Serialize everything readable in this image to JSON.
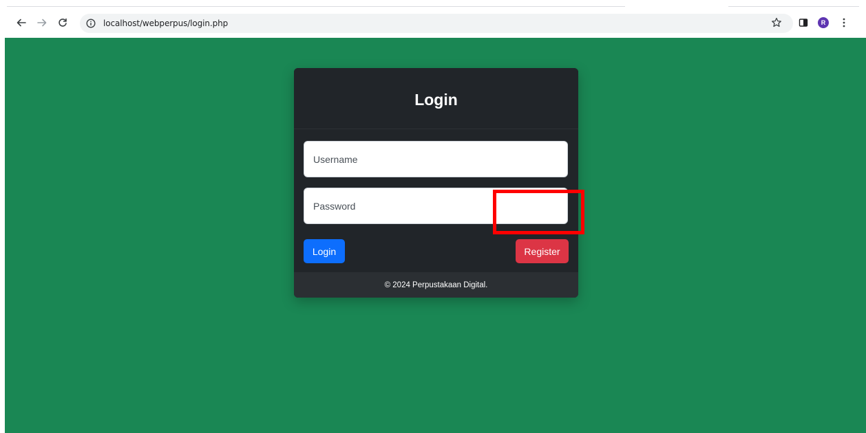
{
  "browser": {
    "url": "localhost/webperpus/login.php",
    "icons": {
      "back": "back-arrow-icon",
      "forward": "forward-arrow-icon",
      "reload": "reload-icon",
      "info": "site-info-icon",
      "bookmark": "star-icon",
      "sidepanel": "side-panel-icon",
      "menu": "kebab-menu-icon"
    },
    "profile_initial": "R"
  },
  "page": {
    "background_color": "#1a8754"
  },
  "login_card": {
    "title": "Login",
    "username_placeholder": "Username",
    "password_placeholder": "Password",
    "login_label": "Login",
    "register_label": "Register",
    "footer_text": "© 2024 Perpustakaan Digital."
  },
  "colors": {
    "card": "#212529",
    "login_button": "#0d6efd",
    "register_button": "#dc3545",
    "highlight": "#ff0000"
  }
}
